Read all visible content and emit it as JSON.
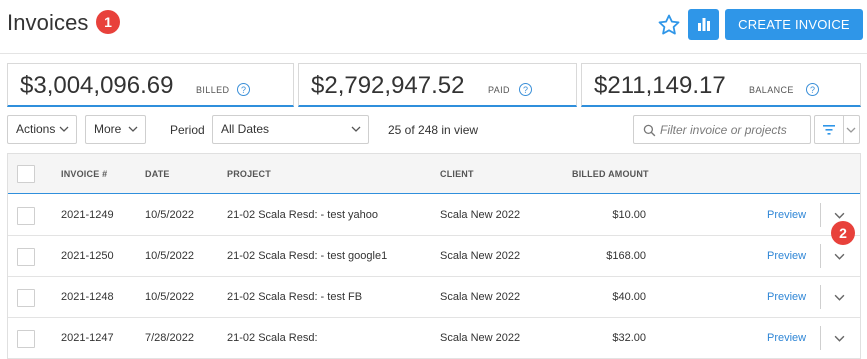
{
  "header": {
    "title": "Invoices",
    "create_label": "CREATE INVOICE",
    "badge_1": "1",
    "badge_2": "2"
  },
  "summary": {
    "billed_amount": "$3,004,096.69",
    "billed_label": "BILLED",
    "paid_amount": "$2,792,947.52",
    "paid_label": "PAID",
    "balance_amount": "$211,149.17",
    "balance_label": "BALANCE",
    "help_glyph": "?"
  },
  "toolbar": {
    "actions_label": "Actions",
    "more_label": "More",
    "period_label": "Period",
    "period_value": "All Dates",
    "in_view": "25 of 248 in view",
    "search_placeholder": "Filter invoice or projects"
  },
  "table": {
    "columns": [
      "INVOICE #",
      "DATE",
      "PROJECT",
      "CLIENT",
      "BILLED AMOUNT"
    ],
    "preview_label": "Preview",
    "rows": [
      {
        "invoice": "2021-1249",
        "date": "10/5/2022",
        "project": "21-02 Scala Resd: - test yahoo",
        "client": "Scala New 2022",
        "amount": "$10.00"
      },
      {
        "invoice": "2021-1250",
        "date": "10/5/2022",
        "project": "21-02 Scala Resd: - test google1",
        "client": "Scala New 2022",
        "amount": "$168.00"
      },
      {
        "invoice": "2021-1248",
        "date": "10/5/2022",
        "project": "21-02 Scala Resd: - test FB",
        "client": "Scala New 2022",
        "amount": "$40.00"
      },
      {
        "invoice": "2021-1247",
        "date": "7/28/2022",
        "project": "21-02 Scala Resd:",
        "client": "Scala New 2022",
        "amount": "$32.00"
      }
    ]
  },
  "icons": {
    "star": "star-icon",
    "chart": "bar-chart-icon",
    "search": "search-icon",
    "filter": "filter-icon",
    "chevron": "chevron-down-icon"
  },
  "colors": {
    "accent": "#2f96e8",
    "badge": "#e8413b",
    "link": "#2f86d6"
  }
}
